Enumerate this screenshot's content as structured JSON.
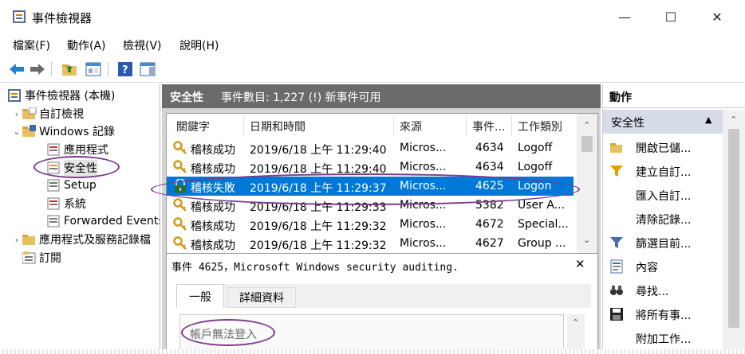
{
  "window": {
    "title": "事件檢視器",
    "controls": {
      "minimize": "—",
      "maximize": "☐",
      "close": "✕"
    }
  },
  "menu": [
    "檔案(F)",
    "動作(A)",
    "檢視(V)",
    "說明(H)"
  ],
  "tree": {
    "root": "事件檢視器 (本機)",
    "items": [
      {
        "label": "自訂檢視",
        "level": 1,
        "arrow": "›"
      },
      {
        "label": "Windows 記錄",
        "level": 1,
        "arrow": "⌄"
      },
      {
        "label": "應用程式",
        "level": 2
      },
      {
        "label": "安全性",
        "level": 2
      },
      {
        "label": "Setup",
        "level": 2
      },
      {
        "label": "系統",
        "level": 2
      },
      {
        "label": "Forwarded Events",
        "level": 2
      },
      {
        "label": "應用程式及服務記錄檔",
        "level": 1,
        "arrow": "›"
      },
      {
        "label": "訂閱",
        "level": 1
      }
    ]
  },
  "center": {
    "header_title": "安全性",
    "header_info": "事件數目: 1,227 (!) 新事件可用",
    "columns": [
      "關鍵字",
      "日期和時間",
      "來源",
      "事件...",
      "工作類別"
    ],
    "rows": [
      {
        "keyword": "稽核成功",
        "datetime": "2019/6/18 上午 11:29:40",
        "source": "Micros...",
        "event_id": "4634",
        "category": "Logoff",
        "icon": "key-icon"
      },
      {
        "keyword": "稽核成功",
        "datetime": "2019/6/18 上午 11:29:40",
        "source": "Micros...",
        "event_id": "4634",
        "category": "Logoff",
        "icon": "key-icon"
      },
      {
        "keyword": "稽核失敗",
        "datetime": "2019/6/18 上午 11:29:37",
        "source": "Micros...",
        "event_id": "4625",
        "category": "Logon",
        "icon": "lock-icon",
        "selected": true
      },
      {
        "keyword": "稽核成功",
        "datetime": "2019/6/18 上午 11:29:33",
        "source": "Micros...",
        "event_id": "5382",
        "category": "User A...",
        "icon": "key-icon"
      },
      {
        "keyword": "稽核成功",
        "datetime": "2019/6/18 上午 11:29:32",
        "source": "Micros...",
        "event_id": "4672",
        "category": "Special...",
        "icon": "key-icon"
      },
      {
        "keyword": "稽核成功",
        "datetime": "2019/6/18 上午 11:29:32",
        "source": "Micros...",
        "event_id": "4627",
        "category": "Group ...",
        "icon": "key-icon"
      }
    ],
    "detail_title": "事件 4625，Microsoft Windows security auditing.",
    "detail_close": "✕",
    "detail_tabs": [
      "一般",
      "詳細資料"
    ],
    "detail_text": "帳戶無法登入"
  },
  "actions": {
    "header": "動作",
    "section": "安全性",
    "items": [
      {
        "label": "開啟已儲...",
        "icon": "folder-open-icon"
      },
      {
        "label": "建立自訂...",
        "icon": "filter-new-icon"
      },
      {
        "label": "匯入自訂...",
        "icon": ""
      },
      {
        "label": "清除記錄...",
        "icon": ""
      },
      {
        "label": "篩選目前...",
        "icon": "filter-icon"
      },
      {
        "label": "內容",
        "icon": "properties-icon"
      },
      {
        "label": "尋找...",
        "icon": "binoculars-icon"
      },
      {
        "label": "將所有事...",
        "icon": "save-icon"
      },
      {
        "label": "附加工作...",
        "icon": ""
      }
    ]
  }
}
